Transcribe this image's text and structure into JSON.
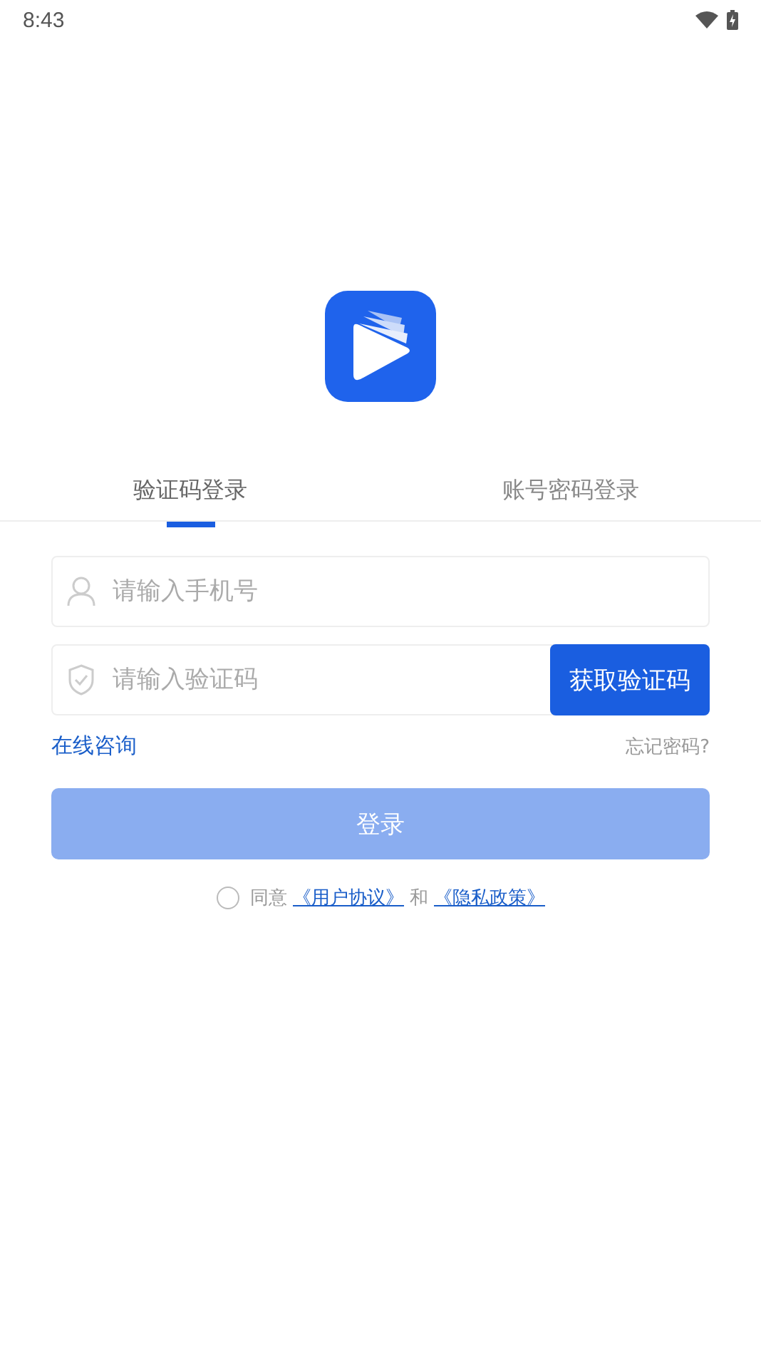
{
  "status_bar": {
    "time": "8:43"
  },
  "tabs": [
    {
      "label": "验证码登录",
      "selected": true
    },
    {
      "label": "账号密码登录",
      "selected": false
    }
  ],
  "phone_field": {
    "placeholder": "请输入手机号"
  },
  "code_field": {
    "placeholder": "请输入验证码"
  },
  "get_code_button": "获取验证码",
  "consult_link": "在线咨询",
  "forgot_link": "忘记密码?",
  "login_button": {
    "label": "登录",
    "disabled": true
  },
  "agreement": {
    "checked": false,
    "prefix": "同意",
    "link_1": "《用户协议》",
    "joiner": "和",
    "link_2": "《隐私政策》"
  }
}
